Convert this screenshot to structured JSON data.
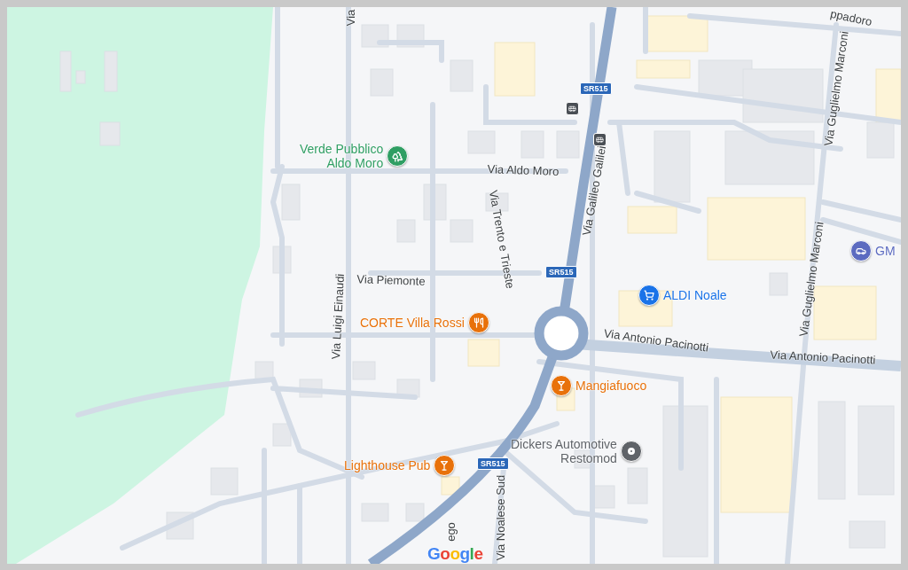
{
  "map": {
    "pois": [
      {
        "name": "Verde Pubblico\nAldo Moro",
        "kind": "park",
        "color": "#2f9e63"
      },
      {
        "name": "CORTE Villa Rossi",
        "kind": "restaurant",
        "color": "#e8710a"
      },
      {
        "name": "Mangiafuoco",
        "kind": "bar",
        "color": "#e8710a"
      },
      {
        "name": "Lighthouse Pub",
        "kind": "bar",
        "color": "#e8710a"
      },
      {
        "name": "ALDI Noale",
        "kind": "shop",
        "color": "#1a73e8"
      },
      {
        "name": "Dickers Automotive\nRestomod",
        "kind": "place",
        "color": "#5f6368"
      },
      {
        "name": "GM",
        "kind": "car",
        "color": "#5c6bc0"
      }
    ],
    "streets": [
      "Via",
      "Via Aldo Moro",
      "Via Trento e Trieste",
      "Via Galileo Galilei",
      "Via Piemonte",
      "Via Luigi Einaudi",
      "Via Antonio Pacinotti",
      "Via Antonio Pacinotti",
      "Via Guglielmo Marconi",
      "Via Guglielmo Marconi",
      "ppadoro",
      "Via Noalese Sud",
      "ego"
    ],
    "shields": [
      "SR515",
      "SR515",
      "SR515"
    ],
    "logo": "Google"
  }
}
